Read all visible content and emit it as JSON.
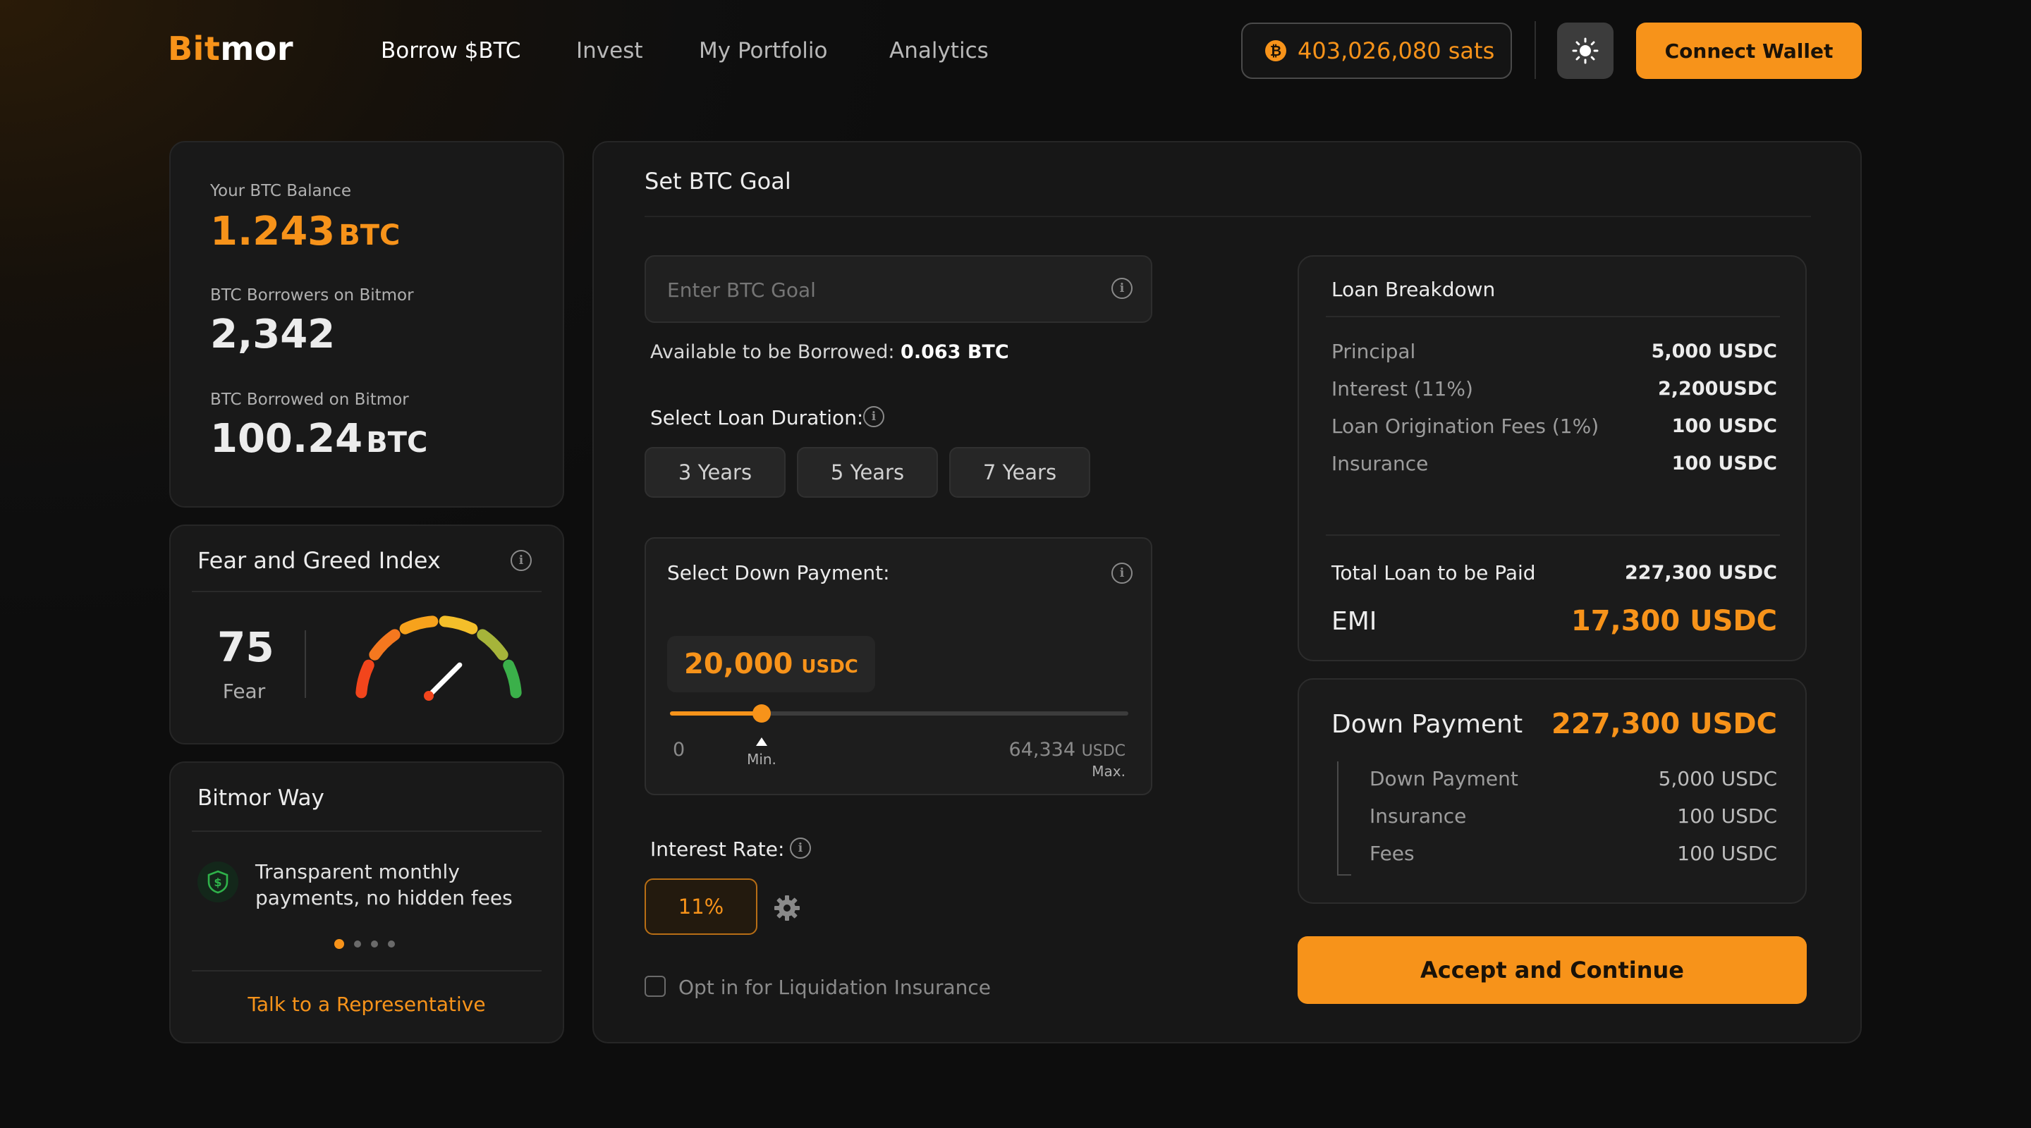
{
  "brand": {
    "part1": "Bit",
    "part2": "mor"
  },
  "nav": [
    {
      "label": "Borrow $BTC",
      "active": true
    },
    {
      "label": "Invest",
      "active": false
    },
    {
      "label": "My Portfolio",
      "active": false
    },
    {
      "label": "Analytics",
      "active": false
    }
  ],
  "header": {
    "sats_balance": "403,026,080 sats",
    "btc_symbol": "₿",
    "connect_label": "Connect Wallet",
    "theme_icon": "sun-icon"
  },
  "stats": {
    "balance_label": "Your BTC Balance",
    "balance_value": "1.243",
    "balance_unit": "BTC",
    "borrowers_label": "BTC Borrowers on Bitmor",
    "borrowers_value": "2,342",
    "borrowed_label": "BTC Borrowed on Bitmor",
    "borrowed_value": "100.24",
    "borrowed_unit": "BTC"
  },
  "fear_greed": {
    "title": "Fear and Greed Index",
    "value": "75",
    "label": "Fear",
    "gauge_level": 0.75,
    "segment_colors": [
      "#f2451c",
      "#f5781f",
      "#f7a21c",
      "#f4bf2a",
      "#a6b43a",
      "#3bb04a"
    ]
  },
  "bitmor_way": {
    "title": "Bitmor Way",
    "item_text_line1": "Transparent monthly",
    "item_text_line2": "payments, no hidden fees",
    "icon": "shield-dollar-icon",
    "active_dot": 0,
    "dot_count": 4,
    "cta": "Talk to a Representative"
  },
  "goal": {
    "title": "Set BTC Goal",
    "input_placeholder": "Enter BTC Goal",
    "available_label": "Available to be Borrowed:",
    "available_value": "0.063 BTC",
    "duration_label": "Select Loan Duration:",
    "durations": [
      "3 Years",
      "5 Years",
      "7 Years"
    ],
    "down_payment_label": "Select Down Payment:",
    "down_payment_value": "20,000",
    "down_payment_unit": "USDC",
    "slider_min": "0",
    "slider_max": "64,334",
    "slider_max_unit": "USDC",
    "min_label": "Min.",
    "max_label": "Max.",
    "slider_fraction": 0.2,
    "interest_label": "Interest Rate:",
    "interest_value": "11%",
    "insurance_opt_in": "Opt in for Liquidation Insurance"
  },
  "breakdown": {
    "title": "Loan Breakdown",
    "rows": [
      {
        "label": "Principal",
        "value": "5,000 USDC"
      },
      {
        "label": "Interest (11%)",
        "value": "2,200USDC"
      },
      {
        "label": "Loan Origination Fees (1%)",
        "value": "100 USDC"
      },
      {
        "label": "Insurance",
        "value": "100 USDC"
      }
    ],
    "total_label": "Total Loan to be Paid",
    "total_value": "227,300 USDC",
    "emi_label": "EMI",
    "emi_value": "17,300 USDC"
  },
  "down_payment": {
    "title": "Down Payment",
    "value": "227,300 USDC",
    "rows": [
      {
        "label": "Down Payment",
        "value": "5,000 USDC"
      },
      {
        "label": "Insurance",
        "value": "100 USDC"
      },
      {
        "label": "Fees",
        "value": "100 USDC"
      }
    ]
  },
  "accept_label": "Accept and Continue",
  "colors": {
    "accent": "#f7931a",
    "card": "#191919",
    "border": "#262626"
  }
}
